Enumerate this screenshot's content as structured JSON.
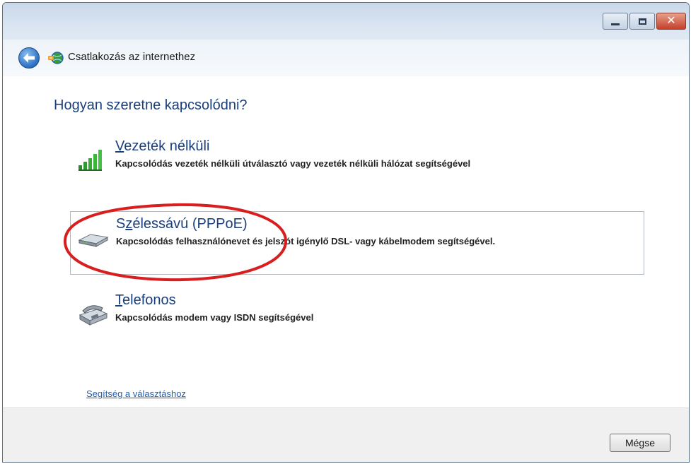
{
  "window": {
    "title": "Csatlakozás az internethez",
    "close_color": "#c4402a"
  },
  "main": {
    "heading": "Hogyan szeretne kapcsolódni?",
    "options": [
      {
        "icon": "wireless-signal-icon",
        "title_first": "V",
        "title_rest": "ezeték nélküli",
        "description": "Kapcsolódás vezeték nélküli útválasztó vagy vezeték nélküli hálózat segítségével"
      },
      {
        "icon": "broadband-modem-icon",
        "title_before": "S",
        "title_ul": "z",
        "title_after": "élessávú (PPPoE)",
        "description": "Kapcsolódás felhasználónevet és jelszót igénylő DSL- vagy kábelmodem segítségével.",
        "selected": true
      },
      {
        "icon": "telephone-modem-icon",
        "title_first": "T",
        "title_rest": "elefonos",
        "description": "Kapcsolódás modem vagy ISDN segítségével"
      }
    ],
    "help_link": "Segítség a választáshoz"
  },
  "footer": {
    "cancel_label": "Mégse"
  },
  "annotation": {
    "color": "#d81e1e"
  }
}
